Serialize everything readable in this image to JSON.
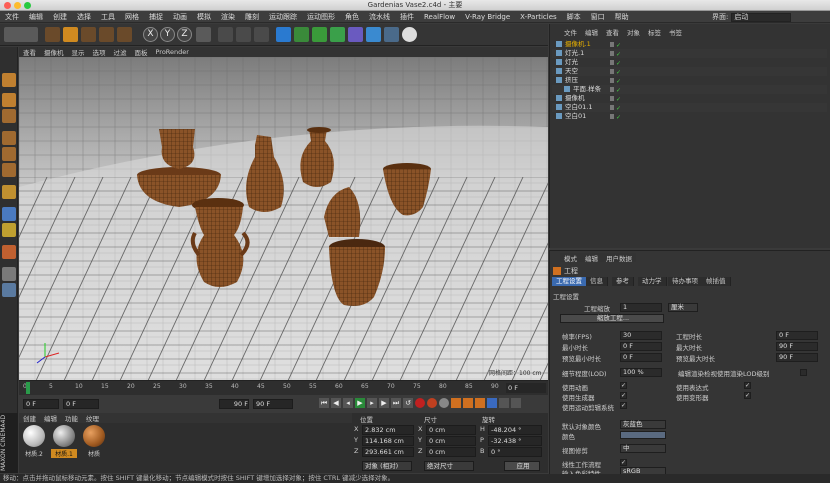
{
  "window": {
    "title": "Gardenias Vase2.c4d - 主要",
    "layout_label": "界面:",
    "layout_value": "启动"
  },
  "menu": [
    "文件",
    "编辑",
    "创建",
    "选择",
    "工具",
    "网格",
    "捕捉",
    "动画",
    "模拟",
    "渲染",
    "雕刻",
    "运动跟踪",
    "运动图形",
    "角色",
    "流水线",
    "插件",
    "RealFlow",
    "V-Ray Bridge",
    "X-Particles",
    "脚本",
    "窗口",
    "帮助"
  ],
  "toolbar_axes": [
    "X",
    "Y",
    "Z"
  ],
  "viewport_menu": [
    "查看",
    "摄像机",
    "显示",
    "选项",
    "过滤",
    "面板",
    "ProRender"
  ],
  "timeline": {
    "ticks": [
      "0",
      "5",
      "10",
      "15",
      "20",
      "25",
      "30",
      "35",
      "40",
      "45",
      "50",
      "55",
      "60",
      "65",
      "70",
      "75",
      "80",
      "85",
      "90"
    ],
    "frame_display": "0 F"
  },
  "transport": {
    "start": "0 F",
    "current": "0 F",
    "end": "90 F",
    "end2": "90 F"
  },
  "materials": {
    "menu": [
      "创建",
      "编辑",
      "功能",
      "纹理"
    ],
    "items": [
      "材质.2",
      "材质.1",
      "材质"
    ]
  },
  "coords": {
    "headers": [
      "位置",
      "尺寸",
      "旋转"
    ],
    "rows": [
      {
        "axis": "X",
        "pos": "2.832 cm",
        "size_axis": "X",
        "size": "0 cm",
        "rot_axis": "H",
        "rot": "-48.204 °"
      },
      {
        "axis": "Y",
        "pos": "114.168 cm",
        "size_axis": "Y",
        "size": "0 cm",
        "rot_axis": "P",
        "rot": "-32.438 °"
      },
      {
        "axis": "Z",
        "pos": "293.661 cm",
        "size_axis": "Z",
        "size": "0 cm",
        "rot_axis": "B",
        "rot": "0 °"
      }
    ],
    "mode_object": "对象 (相对)",
    "mode_size": "绝对尺寸",
    "apply": "应用"
  },
  "object_manager": {
    "menu": [
      "文件",
      "编辑",
      "查看",
      "对象",
      "标签",
      "书签"
    ],
    "items": [
      {
        "name": "摄像机.1",
        "indent": 0,
        "color": "#e8b000"
      },
      {
        "name": "灯光.1",
        "indent": 0,
        "color": "#ddd"
      },
      {
        "name": "灯光",
        "indent": 0,
        "color": "#ddd"
      },
      {
        "name": "天空",
        "indent": 0,
        "color": "#ddd"
      },
      {
        "name": "挤压",
        "indent": 0,
        "color": "#ddd"
      },
      {
        "name": "平面.样条",
        "indent": 1,
        "color": "#ddd"
      },
      {
        "name": "摄像机",
        "indent": 0,
        "color": "#ddd"
      },
      {
        "name": "空白01.1",
        "indent": 0,
        "color": "#ddd"
      },
      {
        "name": "空白01",
        "indent": 0,
        "color": "#ddd"
      }
    ]
  },
  "attributes": {
    "menu": [
      "模式",
      "编辑",
      "用户数据"
    ],
    "title": "工程",
    "tabs": [
      "工程设置",
      "信息",
      "参考",
      "动力学",
      "待办事项",
      "帧插值"
    ],
    "section": "工程设置",
    "scale_label": "工程缩放",
    "scale_value": "1",
    "scale_unit": "厘米",
    "scale_button": "缩放工程...",
    "left": [
      {
        "label": "帧率(FPS)",
        "value": "30"
      },
      {
        "label": "最小时长",
        "value": "0 F"
      },
      {
        "label": "预览最小时长",
        "value": "0 F"
      }
    ],
    "right": [
      {
        "label": "工程时长",
        "value": "0 F"
      },
      {
        "label": "最大时长",
        "value": "90 F"
      },
      {
        "label": "预览最大时长",
        "value": "90 F"
      }
    ],
    "lod_label": "细节程度(LOD)",
    "lod_value": "100 %",
    "lod_option": "编辑渲染检视使用渲染LOD级别",
    "checks_left": [
      "使用动画",
      "使用生成器",
      "使用运动剪辑系统"
    ],
    "checks_right": [
      "使用表达式",
      "使用变形器"
    ],
    "default_color_label": "默认对象颜色",
    "default_color_value": "灰蓝色",
    "color_label": "颜色",
    "clipping_label": "视图修剪",
    "clipping_value": "中",
    "linear_label": "线性工作流程",
    "input_color_label": "输入色彩特性",
    "input_color_value": "sRGB"
  },
  "status_text": "移动：点击并拖动鼠标移动元素。按住 SHIFT 键量化移动；节点编辑模式时按住 SHIFT 键增加选择对象；按住 CTRL 键减少选择对象。",
  "brand": "MAXON CINEMA4D"
}
